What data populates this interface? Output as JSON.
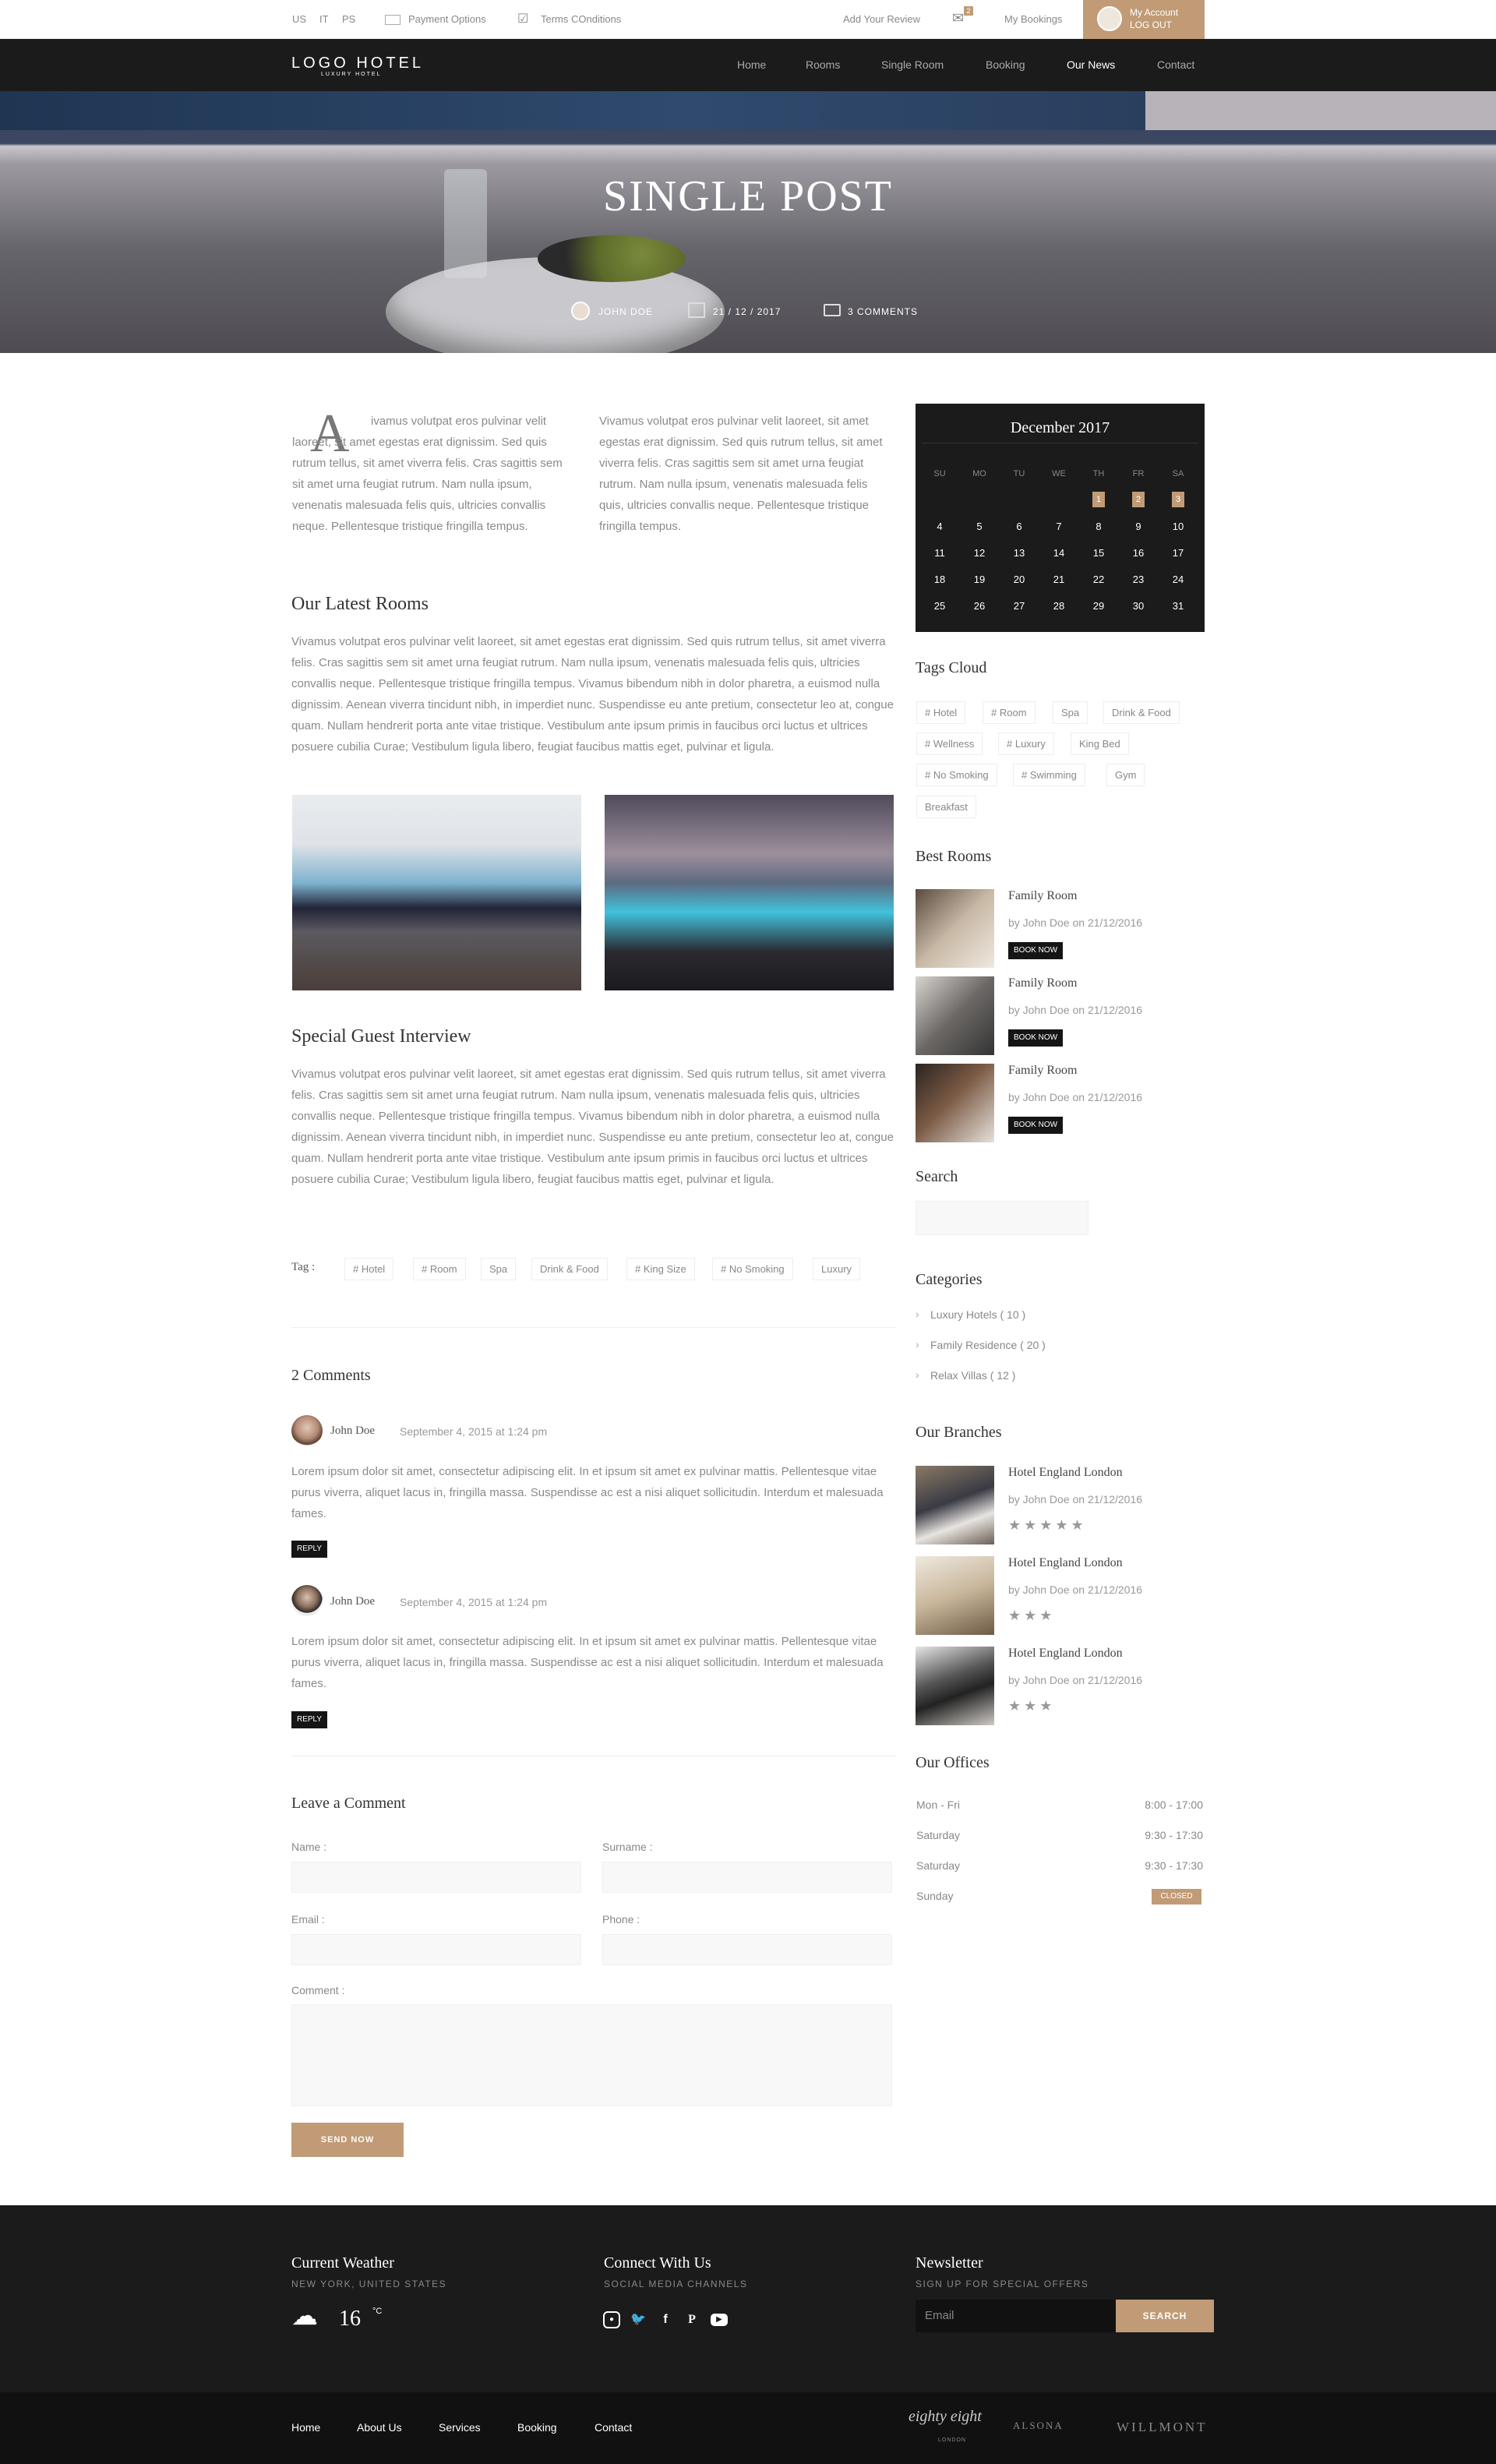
{
  "topbar": {
    "langs": [
      "US",
      "IT",
      "PS"
    ],
    "payment": "Payment Options",
    "terms": "Terms COnditions",
    "review": "Add Your Review",
    "mail_count": "2",
    "bookings": "My Bookings",
    "account": "My Account",
    "logout": "LOG OUT"
  },
  "nav": {
    "logo": "LOGO HOTEL",
    "logo_sub": "LUXURY HOTEL",
    "items": [
      "Home",
      "Rooms",
      "Single Room",
      "Booking",
      "Our News",
      "Contact"
    ],
    "active": "Our News"
  },
  "hero": {
    "title": "SINGLE POST",
    "author": "JOHN DOE",
    "date": "21 / 12 / 2017",
    "comments": "3 COMMENTS"
  },
  "intro": {
    "dropcap": "A",
    "col1": "ivamus volutpat eros pulvinar velit laoreet, sit amet egestas erat dignissim. Sed quis rutrum tellus, sit amet viverra felis. Cras sagittis sem sit amet urna feugiat rutrum. Nam nulla ipsum, venenatis malesuada felis quis, ultricies convallis neque. Pellentesque tristique fringilla tempus.",
    "col2": "Vivamus volutpat eros pulvinar velit laoreet, sit amet egestas erat dignissim. Sed quis rutrum tellus, sit amet viverra felis. Cras sagittis sem sit amet urna feugiat rutrum. Nam nulla ipsum, venenatis malesuada felis quis, ultricies convallis neque. Pellentesque tristique fringilla tempus."
  },
  "rooms": {
    "title": "Our Latest Rooms",
    "text": "Vivamus volutpat eros pulvinar velit laoreet, sit amet egestas erat dignissim. Sed quis rutrum tellus, sit amet viverra felis. Cras sagittis sem sit amet urna feugiat rutrum. Nam nulla ipsum, venenatis malesuada felis quis, ultricies convallis neque. Pellentesque tristique fringilla tempus. Vivamus bibendum nibh in dolor pharetra, a euismod nulla dignissim. Aenean viverra tincidunt nibh, in imperdiet nunc. Suspendisse eu ante pretium, consectetur leo at, congue quam. Nullam hendrerit porta ante vitae tristique. Vestibulum ante ipsum primis in faucibus orci luctus et ultrices posuere cubilia Curae; Vestibulum ligula libero, feugiat faucibus mattis eget, pulvinar et ligula."
  },
  "interview": {
    "title": "Special Guest Interview",
    "text": "Vivamus volutpat eros pulvinar velit laoreet, sit amet egestas erat dignissim. Sed quis rutrum tellus, sit amet viverra felis. Cras sagittis sem sit amet urna feugiat rutrum. Nam nulla ipsum, venenatis malesuada felis quis, ultricies convallis neque. Pellentesque tristique fringilla tempus. Vivamus bibendum nibh in dolor pharetra, a euismod nulla dignissim. Aenean viverra tincidunt nibh, in imperdiet nunc. Suspendisse eu ante pretium, consectetur leo at, congue quam. Nullam hendrerit porta ante vitae tristique. Vestibulum ante ipsum primis in faucibus orci luctus et ultrices posuere cubilia Curae; Vestibulum ligula libero, feugiat faucibus mattis eget, pulvinar et ligula."
  },
  "post_tags": {
    "label": "Tag :",
    "items": [
      "# Hotel",
      "# Room",
      "Spa",
      "Drink & Food",
      "# King Size",
      "# No Smoking",
      "Luxury"
    ]
  },
  "comments": {
    "title": "2 Comments",
    "items": [
      {
        "name": "John Doe",
        "date": "September 4, 2015 at 1:24 pm",
        "text": "Lorem ipsum dolor sit amet, consectetur adipiscing elit. In et ipsum sit amet ex pulvinar mattis. Pellentesque vitae purus viverra, aliquet lacus in, fringilla massa. Suspendisse ac est a nisi aliquet sollicitudin. Interdum et malesuada fames.",
        "reply": "REPLY"
      },
      {
        "name": "John Doe",
        "date": "September 4, 2015 at 1:24 pm",
        "text": "Lorem ipsum dolor sit amet, consectetur adipiscing elit. In et ipsum sit amet ex pulvinar mattis. Pellentesque vitae purus viverra, aliquet lacus in, fringilla massa. Suspendisse ac est a nisi aliquet sollicitudin. Interdum et malesuada fames.",
        "reply": "REPLY"
      }
    ]
  },
  "form": {
    "title": "Leave a Comment",
    "name": "Name :",
    "surname": "Surname :",
    "email": "Email :",
    "phone": "Phone :",
    "comment": "Comment :",
    "submit": "SEND NOW"
  },
  "calendar": {
    "title": "December 2017",
    "days": [
      "SU",
      "MO",
      "TU",
      "WE",
      "TH",
      "FR",
      "SA"
    ],
    "week1": [
      "1",
      "2",
      "3"
    ],
    "weeks": [
      [
        "4",
        "5",
        "6",
        "7",
        "8",
        "9",
        "10"
      ],
      [
        "11",
        "12",
        "13",
        "14",
        "15",
        "16",
        "17"
      ],
      [
        "18",
        "19",
        "20",
        "21",
        "22",
        "23",
        "24"
      ],
      [
        "25",
        "26",
        "27",
        "28",
        "29",
        "30",
        "31"
      ]
    ]
  },
  "tags_cloud": {
    "title": "Tags Cloud",
    "items": [
      "# Hotel",
      "# Room",
      "Spa",
      "Drink & Food",
      "# Wellness",
      "# Luxury",
      "King Bed",
      "# No Smoking",
      "# Swimming",
      "Gym",
      "Breakfast"
    ]
  },
  "best_rooms": {
    "title": "Best Rooms",
    "items": [
      {
        "name": "Family Room",
        "by": "by John Doe on 21/12/2016",
        "btn": "BOOK NOW"
      },
      {
        "name": "Family Room",
        "by": "by John Doe on 21/12/2016",
        "btn": "BOOK NOW"
      },
      {
        "name": "Family Room",
        "by": "by John Doe on 21/12/2016",
        "btn": "BOOK NOW"
      }
    ]
  },
  "search": {
    "title": "Search"
  },
  "categories": {
    "title": "Categories",
    "items": [
      "Luxury Hotels ( 10 )",
      "Family Residence ( 20 )",
      "Relax Villas ( 12 )"
    ]
  },
  "branches": {
    "title": "Our Branches",
    "items": [
      {
        "name": "Hotel England London",
        "by": "by John Doe on 21/12/2016",
        "stars": 5
      },
      {
        "name": "Hotel England London",
        "by": "by John Doe on 21/12/2016",
        "stars": 3
      },
      {
        "name": "Hotel England London",
        "by": "by John Doe on 21/12/2016",
        "stars": 3
      }
    ]
  },
  "offices": {
    "title": "Our Offices",
    "rows": [
      {
        "day": "Mon - Fri",
        "hours": "8:00 - 17:00"
      },
      {
        "day": "Saturday",
        "hours": "9:30 - 17:30"
      },
      {
        "day": "Saturday",
        "hours": "9:30 - 17:30"
      },
      {
        "day": "Sunday",
        "hours": "CLOSED"
      }
    ]
  },
  "footer": {
    "weather_title": "Current Weather",
    "weather_sub": "NEW YORK, UNITED STATES",
    "temp": "16",
    "unit": "°C",
    "connect_title": "Connect With Us",
    "connect_sub": "SOCIAL MEDIA CHANNELS",
    "news_title": "Newsletter",
    "news_sub": "SIGN UP FOR SPECIAL OFFERS",
    "email_placeholder": "Email",
    "search_btn": "SEARCH",
    "links": [
      "Home",
      "About Us",
      "Services",
      "Booking",
      "Contact"
    ],
    "partners": [
      "eighty eight",
      "LONDON",
      "ALSONA",
      "WILLMONT"
    ]
  },
  "colors": {
    "accent": "#c19b76",
    "dark": "#1b1b1b"
  }
}
